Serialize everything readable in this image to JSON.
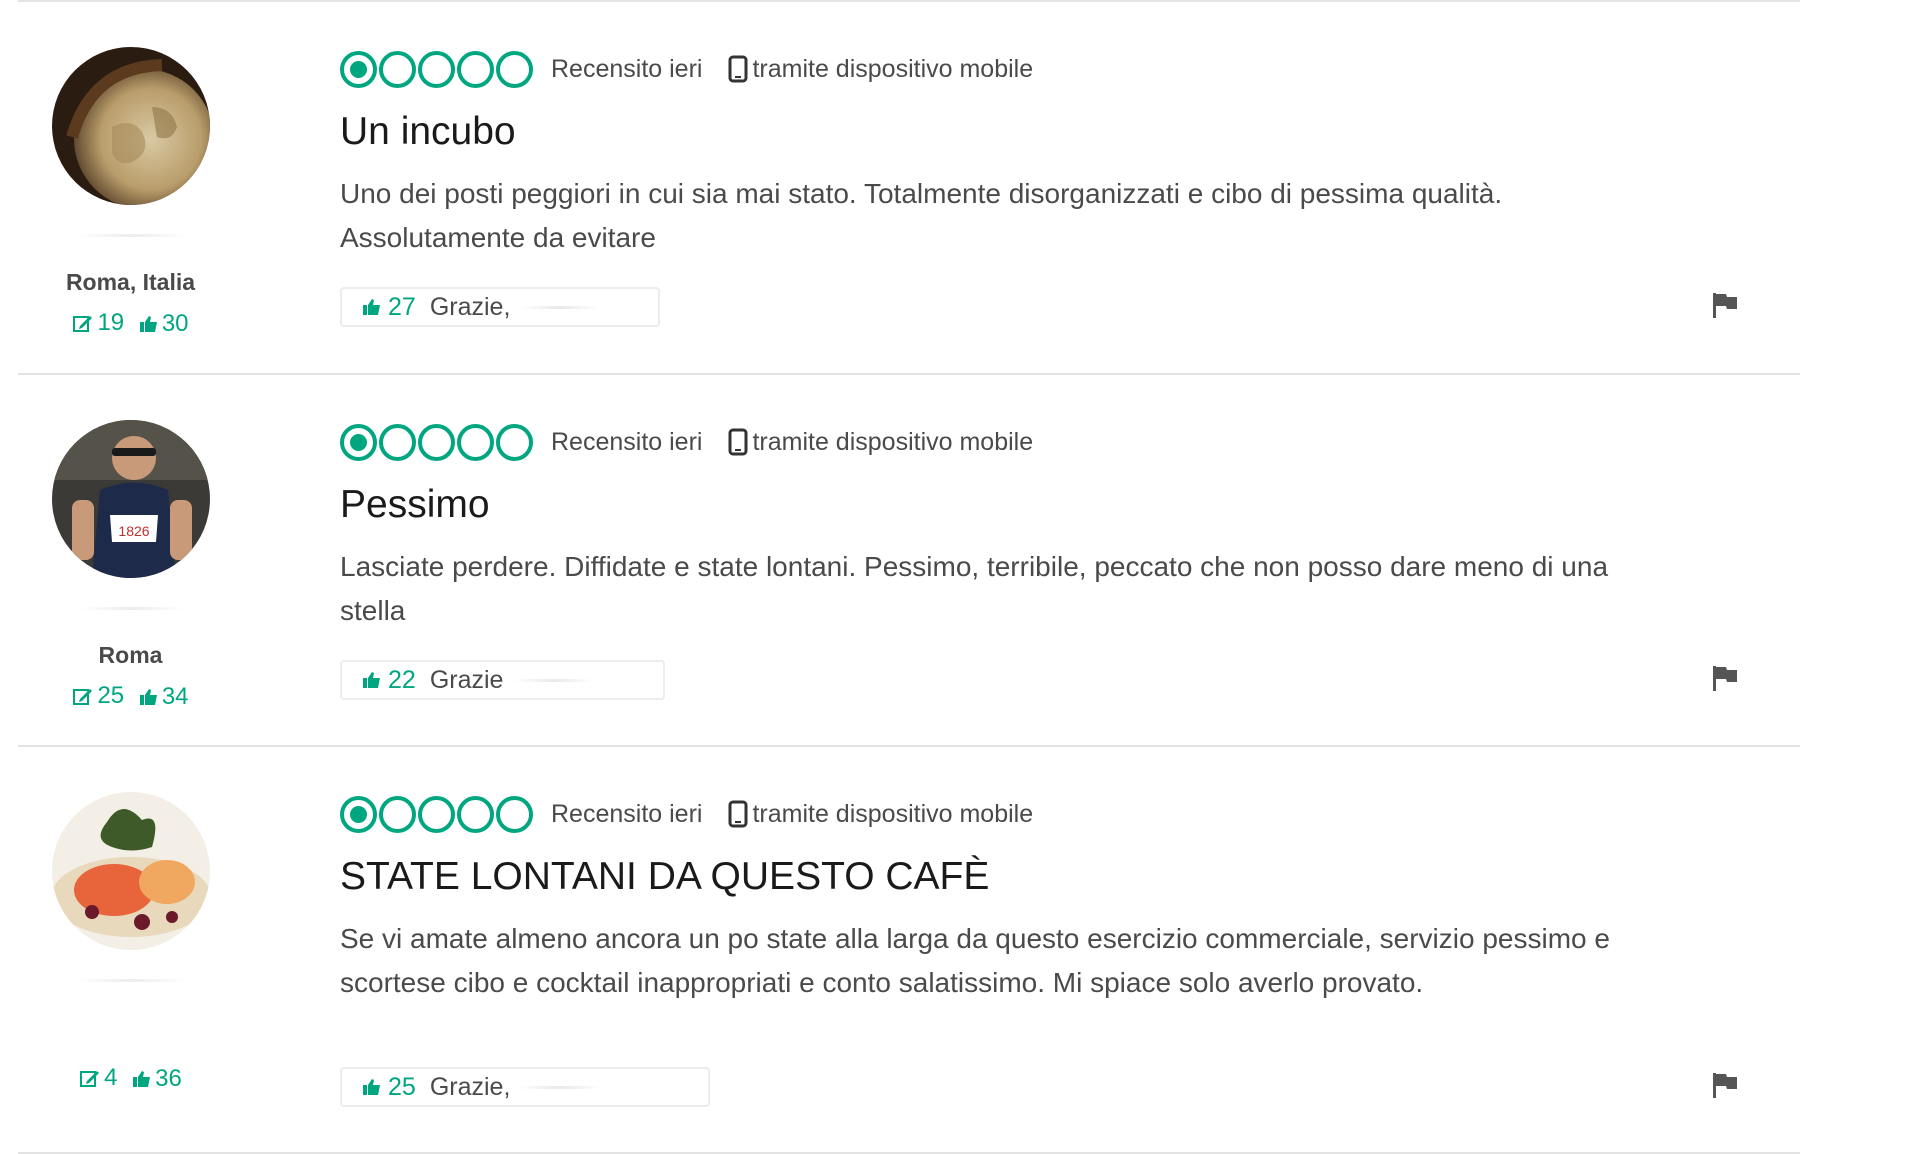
{
  "colors": {
    "accent": "#00a680",
    "text": "#4a4a4a",
    "title": "#1a1a1a",
    "separator": "#e3e3e3"
  },
  "reviews": [
    {
      "avatar": "globe-photo",
      "location": "Roma, Italia",
      "contributions": "19",
      "helpful_votes": "30",
      "rating": 1,
      "rating_max": 5,
      "reviewed": "Recensito ieri",
      "device": "tramite dispositivo mobile",
      "title": "Un incubo",
      "text": "Uno dei posti peggiori in cui sia mai stato. Totalmente disorganizzati e cibo di pessima qualità. Assolutamente da evitare",
      "thanks_count": "27",
      "thanks_label": "Grazie, "
    },
    {
      "avatar": "runner-photo",
      "location": "Roma",
      "contributions": "25",
      "helpful_votes": "34",
      "rating": 1,
      "rating_max": 5,
      "reviewed": "Recensito ieri",
      "device": "tramite dispositivo mobile",
      "title": "Pessimo",
      "text": "Lasciate perdere. Diffidate e state lontani. Pessimo, terribile, peccato che non posso dare meno di una stella",
      "thanks_count": "22",
      "thanks_label": "Grazie"
    },
    {
      "avatar": "food-photo",
      "location": "",
      "contributions": "4",
      "helpful_votes": "36",
      "rating": 1,
      "rating_max": 5,
      "reviewed": "Recensito ieri",
      "device": "tramite dispositivo mobile",
      "title": "STATE LONTANI DA QUESTO CAFÈ",
      "text": "Se vi amate almeno ancora un po state alla larga da questo esercizio commerciale, servizio pessimo e scortese cibo e cocktail inappropriati e conto salatissimo. Mi spiace solo averlo provato.",
      "thanks_count": "25",
      "thanks_label": "Grazie, "
    }
  ],
  "icons": {
    "contributions": "pencil-square-icon",
    "helpful": "thumbs-up-icon",
    "device": "mobile-phone-icon",
    "report": "flag-icon"
  }
}
